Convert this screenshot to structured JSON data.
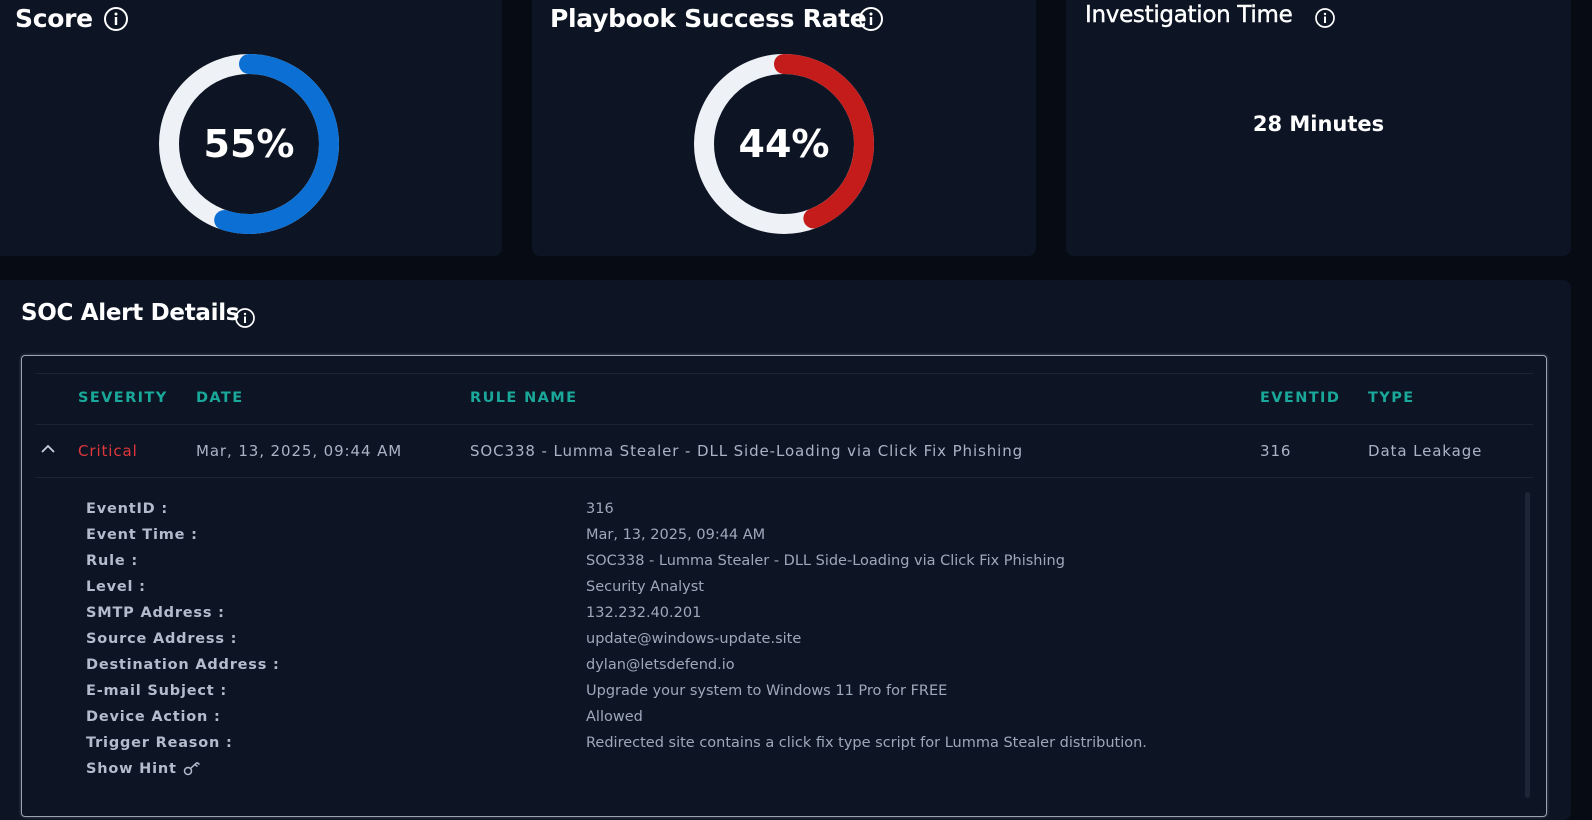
{
  "score_card": {
    "title": "Score",
    "value": 0.55,
    "label": "55%",
    "color": "#0b6fd4",
    "track_color": "#eef1f6"
  },
  "playbook_card": {
    "title": "Playbook Success Rate",
    "value": 0.44,
    "label": "44%",
    "color": "#c41b1b",
    "track_color": "#eef1f6"
  },
  "investigation_card": {
    "title": "Investigation Time",
    "value": "28 Minutes"
  },
  "alert_section": {
    "title": "SOC Alert Details"
  },
  "table": {
    "headers": {
      "severity": "SEVERITY",
      "date": "DATE",
      "rule": "RULE NAME",
      "eventid": "EVENTID",
      "type": "TYPE"
    },
    "row": {
      "severity": "Critical",
      "severity_color": "#e0373d",
      "date": "Mar, 13, 2025, 09:44 AM",
      "rule": "SOC338 - Lumma Stealer - DLL Side-Loading via Click Fix Phishing",
      "eventid": "316",
      "type": "Data Leakage"
    }
  },
  "details": [
    {
      "label": "EventID :",
      "value": "316"
    },
    {
      "label": "Event Time :",
      "value": "Mar, 13, 2025, 09:44 AM"
    },
    {
      "label": "Rule :",
      "value": "SOC338 - Lumma Stealer - DLL Side-Loading via Click Fix Phishing"
    },
    {
      "label": "Level :",
      "value": "Security Analyst"
    },
    {
      "label": "SMTP Address :",
      "value": "132.232.40.201"
    },
    {
      "label": "Source Address :",
      "value": "update@windows-update.site"
    },
    {
      "label": "Destination Address :",
      "value": "dylan@letsdefend.io"
    },
    {
      "label": "E-mail Subject :",
      "value": "Upgrade your system to Windows 11 Pro for FREE"
    },
    {
      "label": "Device Action :",
      "value": "Allowed"
    },
    {
      "label": "Trigger Reason :",
      "value": "Redirected site contains a click fix type script for Lumma Stealer distribution."
    }
  ],
  "show_hint": {
    "label": "Show Hint",
    "icon": "key-icon"
  }
}
